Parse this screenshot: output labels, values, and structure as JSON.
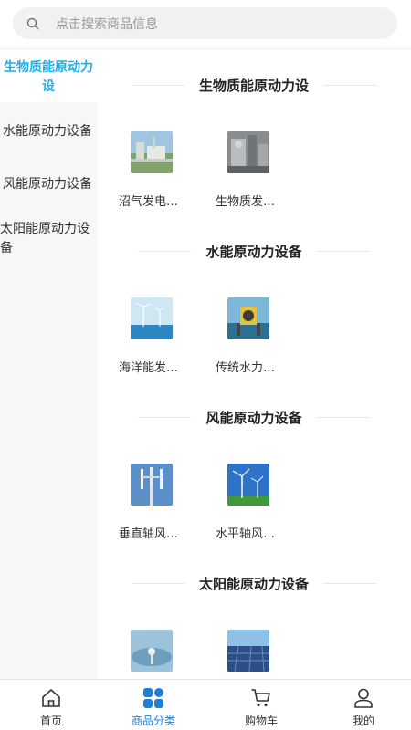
{
  "search": {
    "placeholder": "点击搜索商品信息"
  },
  "sidebar": {
    "items": [
      {
        "label": "生物质能原动力设",
        "active": true
      },
      {
        "label": "水能原动力设备"
      },
      {
        "label": "风能原动力设备"
      },
      {
        "label": "太阳能原动力设备"
      }
    ]
  },
  "sections": [
    {
      "title": "生物质能原动力设",
      "products": [
        {
          "name": "沼气发电…"
        },
        {
          "name": "生物质发…"
        }
      ]
    },
    {
      "title": "水能原动力设备",
      "products": [
        {
          "name": "海洋能发…"
        },
        {
          "name": "传统水力…"
        }
      ]
    },
    {
      "title": "风能原动力设备",
      "products": [
        {
          "name": "垂直轴风…"
        },
        {
          "name": "水平轴风…"
        }
      ]
    },
    {
      "title": "太阳能原动力设备",
      "products": [
        {
          "name": ""
        },
        {
          "name": ""
        }
      ]
    }
  ],
  "tabbar": {
    "items": [
      {
        "label": "首页",
        "icon": "home-icon"
      },
      {
        "label": "商品分类",
        "icon": "category-icon",
        "active": true
      },
      {
        "label": "购物车",
        "icon": "cart-icon"
      },
      {
        "label": "我的",
        "icon": "user-icon"
      }
    ]
  },
  "colors": {
    "accent": "#1eaee8",
    "tab_active": "#1e7fd6"
  }
}
